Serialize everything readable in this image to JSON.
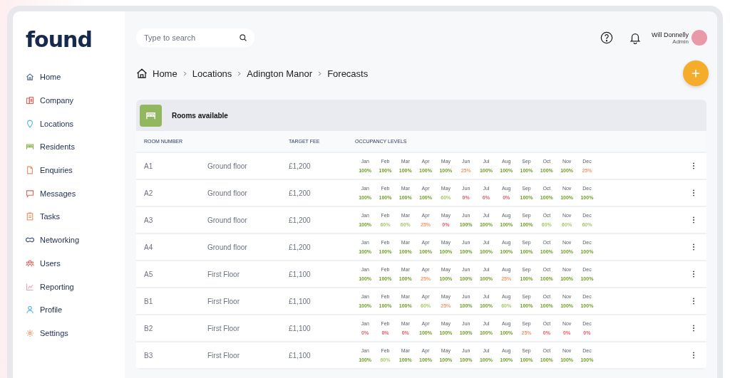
{
  "logo": "found",
  "sidebar": {
    "items": [
      {
        "label": "Home"
      },
      {
        "label": "Company"
      },
      {
        "label": "Locations"
      },
      {
        "label": "Residents"
      },
      {
        "label": "Enquiries"
      },
      {
        "label": "Messages"
      },
      {
        "label": "Tasks"
      },
      {
        "label": "Networking"
      },
      {
        "label": "Users"
      },
      {
        "label": "Reporting"
      },
      {
        "label": "Profile"
      },
      {
        "label": "Settings"
      }
    ]
  },
  "search": {
    "placeholder": "Type to search"
  },
  "user": {
    "name": "Will Donnelly",
    "role": "Admin"
  },
  "breadcrumb": [
    "Home",
    "Locations",
    "Adington Manor",
    "Forecasts"
  ],
  "card": {
    "title": "Rooms available"
  },
  "table": {
    "columns": [
      "ROOM NUMBER",
      "TARGET FEE",
      "OCCUPANCY LEVELS"
    ],
    "rows": [
      {
        "room": "A1",
        "floor": "Ground floor",
        "fee": "£1,200",
        "months": [
          {
            "m": "Jan",
            "v": "100%",
            "kind": "full"
          },
          {
            "m": "Feb",
            "v": "100%",
            "kind": "full"
          },
          {
            "m": "Mar",
            "v": "100%",
            "kind": "full"
          },
          {
            "m": "Apr",
            "v": "100%",
            "kind": "full"
          },
          {
            "m": "May",
            "v": "100%",
            "kind": "full"
          },
          {
            "m": "Jun",
            "v": "25%",
            "kind": "low"
          },
          {
            "m": "Jul",
            "v": "100%",
            "kind": "full"
          },
          {
            "m": "Aug",
            "v": "100%",
            "kind": "full"
          },
          {
            "m": "Sep",
            "v": "100%",
            "kind": "full"
          },
          {
            "m": "Oct",
            "v": "100%",
            "kind": "full"
          },
          {
            "m": "Nov",
            "v": "100%",
            "kind": "full"
          },
          {
            "m": "Dec",
            "v": "25%",
            "kind": "low"
          }
        ]
      },
      {
        "room": "A2",
        "floor": "Ground floor",
        "fee": "£1,200",
        "months": [
          {
            "m": "Jan",
            "v": "100%",
            "kind": "full"
          },
          {
            "m": "Feb",
            "v": "100%",
            "kind": "full"
          },
          {
            "m": "Mar",
            "v": "100%",
            "kind": "full"
          },
          {
            "m": "Apr",
            "v": "100%",
            "kind": "full"
          },
          {
            "m": "May",
            "v": "60%",
            "kind": "high"
          },
          {
            "m": "Jun",
            "v": "0%",
            "kind": "empty"
          },
          {
            "m": "Jul",
            "v": "0%",
            "kind": "empty"
          },
          {
            "m": "Aug",
            "v": "0%",
            "kind": "empty"
          },
          {
            "m": "Sep",
            "v": "100%",
            "kind": "full"
          },
          {
            "m": "Oct",
            "v": "100%",
            "kind": "full"
          },
          {
            "m": "Nov",
            "v": "100%",
            "kind": "full"
          },
          {
            "m": "Dec",
            "v": "100%",
            "kind": "full"
          }
        ]
      },
      {
        "room": "A3",
        "floor": "Ground floor",
        "fee": "£1,200",
        "months": [
          {
            "m": "Jan",
            "v": "100%",
            "kind": "full"
          },
          {
            "m": "Feb",
            "v": "60%",
            "kind": "high"
          },
          {
            "m": "Mar",
            "v": "60%",
            "kind": "high"
          },
          {
            "m": "Apr",
            "v": "25%",
            "kind": "low"
          },
          {
            "m": "May",
            "v": "0%",
            "kind": "empty"
          },
          {
            "m": "Jun",
            "v": "100%",
            "kind": "full"
          },
          {
            "m": "Jul",
            "v": "100%",
            "kind": "full"
          },
          {
            "m": "Aug",
            "v": "100%",
            "kind": "full"
          },
          {
            "m": "Sep",
            "v": "100%",
            "kind": "full"
          },
          {
            "m": "Oct",
            "v": "60%",
            "kind": "high"
          },
          {
            "m": "Nov",
            "v": "60%",
            "kind": "high"
          },
          {
            "m": "Dec",
            "v": "60%",
            "kind": "high"
          }
        ]
      },
      {
        "room": "A4",
        "floor": "Ground floor",
        "fee": "£1,200",
        "months": [
          {
            "m": "Jan",
            "v": "100%",
            "kind": "full"
          },
          {
            "m": "Feb",
            "v": "100%",
            "kind": "full"
          },
          {
            "m": "Mar",
            "v": "100%",
            "kind": "full"
          },
          {
            "m": "Apr",
            "v": "100%",
            "kind": "full"
          },
          {
            "m": "May",
            "v": "100%",
            "kind": "full"
          },
          {
            "m": "Jun",
            "v": "100%",
            "kind": "full"
          },
          {
            "m": "Jul",
            "v": "100%",
            "kind": "full"
          },
          {
            "m": "Aug",
            "v": "100%",
            "kind": "full"
          },
          {
            "m": "Sep",
            "v": "100%",
            "kind": "full"
          },
          {
            "m": "Oct",
            "v": "100%",
            "kind": "full"
          },
          {
            "m": "Nov",
            "v": "100%",
            "kind": "full"
          },
          {
            "m": "Dec",
            "v": "100%",
            "kind": "full"
          }
        ]
      },
      {
        "room": "A5",
        "floor": "First Floor",
        "fee": "£1,100",
        "months": [
          {
            "m": "Jan",
            "v": "100%",
            "kind": "full"
          },
          {
            "m": "Feb",
            "v": "100%",
            "kind": "full"
          },
          {
            "m": "Mar",
            "v": "100%",
            "kind": "full"
          },
          {
            "m": "Apr",
            "v": "25%",
            "kind": "low"
          },
          {
            "m": "May",
            "v": "100%",
            "kind": "full"
          },
          {
            "m": "Jun",
            "v": "100%",
            "kind": "full"
          },
          {
            "m": "Jul",
            "v": "100%",
            "kind": "full"
          },
          {
            "m": "Aug",
            "v": "25%",
            "kind": "low"
          },
          {
            "m": "Sep",
            "v": "100%",
            "kind": "full"
          },
          {
            "m": "Oct",
            "v": "100%",
            "kind": "full"
          },
          {
            "m": "Nov",
            "v": "100%",
            "kind": "full"
          },
          {
            "m": "Dec",
            "v": "100%",
            "kind": "full"
          }
        ]
      },
      {
        "room": "B1",
        "floor": "First Floor",
        "fee": "£1,100",
        "months": [
          {
            "m": "Jan",
            "v": "100%",
            "kind": "full"
          },
          {
            "m": "Feb",
            "v": "100%",
            "kind": "full"
          },
          {
            "m": "Mar",
            "v": "100%",
            "kind": "full"
          },
          {
            "m": "Apr",
            "v": "60%",
            "kind": "high"
          },
          {
            "m": "May",
            "v": "25%",
            "kind": "low"
          },
          {
            "m": "Jun",
            "v": "100%",
            "kind": "full"
          },
          {
            "m": "Jul",
            "v": "100%",
            "kind": "full"
          },
          {
            "m": "Aug",
            "v": "60%",
            "kind": "high"
          },
          {
            "m": "Sep",
            "v": "100%",
            "kind": "full"
          },
          {
            "m": "Oct",
            "v": "100%",
            "kind": "full"
          },
          {
            "m": "Nov",
            "v": "100%",
            "kind": "full"
          },
          {
            "m": "Dec",
            "v": "100%",
            "kind": "full"
          }
        ]
      },
      {
        "room": "B2",
        "floor": "First Floor",
        "fee": "£1,100",
        "months": [
          {
            "m": "Jan",
            "v": "0%",
            "kind": "empty"
          },
          {
            "m": "Feb",
            "v": "0%",
            "kind": "empty"
          },
          {
            "m": "Mar",
            "v": "0%",
            "kind": "empty"
          },
          {
            "m": "Apr",
            "v": "100%",
            "kind": "full"
          },
          {
            "m": "May",
            "v": "100%",
            "kind": "full"
          },
          {
            "m": "Jun",
            "v": "100%",
            "kind": "full"
          },
          {
            "m": "Jul",
            "v": "100%",
            "kind": "full"
          },
          {
            "m": "Aug",
            "v": "100%",
            "kind": "full"
          },
          {
            "m": "Sep",
            "v": "25%",
            "kind": "low"
          },
          {
            "m": "Oct",
            "v": "0%",
            "kind": "empty"
          },
          {
            "m": "Nov",
            "v": "0%",
            "kind": "empty"
          },
          {
            "m": "Dec",
            "v": "0%",
            "kind": "empty"
          }
        ]
      },
      {
        "room": "B3",
        "floor": "First Floor",
        "fee": "£1,100",
        "months": [
          {
            "m": "Jan",
            "v": "100%",
            "kind": "full"
          },
          {
            "m": "Feb",
            "v": "60%",
            "kind": "high"
          },
          {
            "m": "Mar",
            "v": "100%",
            "kind": "full"
          },
          {
            "m": "Apr",
            "v": "100%",
            "kind": "full"
          },
          {
            "m": "May",
            "v": "100%",
            "kind": "full"
          },
          {
            "m": "Jun",
            "v": "100%",
            "kind": "full"
          },
          {
            "m": "Jul",
            "v": "100%",
            "kind": "full"
          },
          {
            "m": "Aug",
            "v": "100%",
            "kind": "full"
          },
          {
            "m": "Sep",
            "v": "100%",
            "kind": "full"
          },
          {
            "m": "Oct",
            "v": "100%",
            "kind": "full"
          },
          {
            "m": "Nov",
            "v": "100%",
            "kind": "full"
          },
          {
            "m": "Dec",
            "v": "100%",
            "kind": "full"
          }
        ]
      }
    ]
  }
}
